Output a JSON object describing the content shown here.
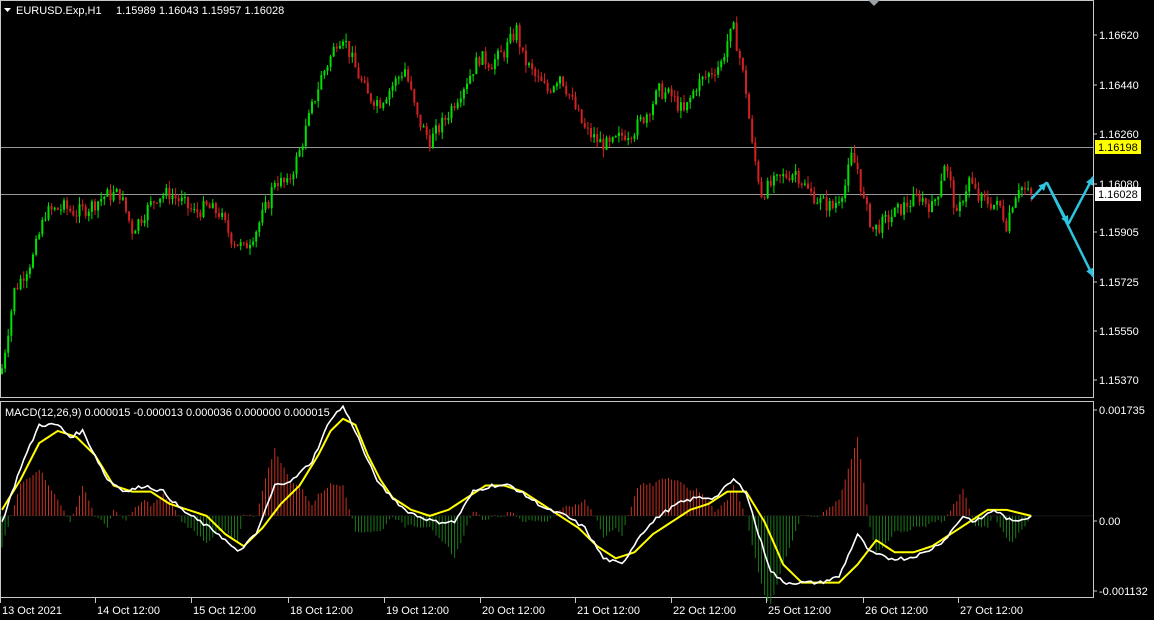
{
  "header": {
    "symbol": "EURUSD.Exp,H1",
    "ohlc": "1.15989 1.16043 1.15957 1.16028"
  },
  "macd_header": "MACD(12,26,9) 0.000015 -0.000013 0.000036 0.000000 0.000015",
  "colors": {
    "bull": "#00e000",
    "bear": "#d42020",
    "grid_line": "#c8c8c8",
    "price_tag_yellow": "#ffff00",
    "price_tag_white": "#ffffff",
    "arrow": "#2ec4de",
    "macd_line": "#ffffff",
    "signal_line": "#ffff00",
    "hist_pos": "#c83020",
    "hist_neg": "#1a7a1a"
  },
  "chart_data": [
    {
      "type": "candlestick",
      "timeframe": "H1",
      "ylim": [
        1.153,
        1.1672
      ],
      "y_ticks": [
        "1.16620",
        "1.16440",
        "1.16260",
        "1.16080",
        "1.15905",
        "1.15725",
        "1.15550",
        "1.15370"
      ],
      "x_ticks": [
        "13 Oct 2021",
        "14 Oct 12:00",
        "15 Oct 12:00",
        "18 Oct 12:00",
        "19 Oct 12:00",
        "20 Oct 12:00",
        "21 Oct 12:00",
        "22 Oct 12:00",
        "25 Oct 12:00",
        "26 Oct 12:00",
        "27 Oct 12:00"
      ],
      "horizontal_lines": [
        {
          "price": 1.16198,
          "label": "1.16198",
          "tag": "yellow"
        },
        {
          "price": 1.16028,
          "label": "1.16028",
          "tag": "white"
        }
      ],
      "close_path": [
        [
          0,
          1.154
        ],
        [
          4,
          1.1568
        ],
        [
          10,
          1.158
        ],
        [
          14,
          1.1596
        ],
        [
          20,
          1.1598
        ],
        [
          24,
          1.1596
        ],
        [
          28,
          1.1598
        ],
        [
          33,
          1.1602
        ],
        [
          38,
          1.1603
        ],
        [
          42,
          1.159
        ],
        [
          46,
          1.1596
        ],
        [
          50,
          1.1602
        ],
        [
          54,
          1.1603
        ],
        [
          58,
          1.16
        ],
        [
          62,
          1.1596
        ],
        [
          66,
          1.1598
        ],
        [
          70,
          1.1596
        ],
        [
          74,
          1.1587
        ],
        [
          78,
          1.1583
        ],
        [
          82,
          1.159
        ],
        [
          86,
          1.16
        ],
        [
          88,
          1.1608
        ],
        [
          92,
          1.1606
        ],
        [
          96,
          1.1618
        ],
        [
          100,
          1.1634
        ],
        [
          103,
          1.1645
        ],
        [
          106,
          1.1652
        ],
        [
          108,
          1.1658
        ],
        [
          110,
          1.166
        ],
        [
          114,
          1.1648
        ],
        [
          118,
          1.1638
        ],
        [
          122,
          1.1636
        ],
        [
          126,
          1.1642
        ],
        [
          130,
          1.1648
        ],
        [
          134,
          1.163
        ],
        [
          138,
          1.1622
        ],
        [
          142,
          1.1628
        ],
        [
          146,
          1.1636
        ],
        [
          150,
          1.1644
        ],
        [
          154,
          1.1652
        ],
        [
          158,
          1.165
        ],
        [
          162,
          1.1654
        ],
        [
          166,
          1.1662
        ],
        [
          168,
          1.1652
        ],
        [
          172,
          1.1645
        ],
        [
          176,
          1.164
        ],
        [
          180,
          1.1646
        ],
        [
          184,
          1.1636
        ],
        [
          188,
          1.1626
        ],
        [
          192,
          1.1622
        ],
        [
          196,
          1.162
        ],
        [
          200,
          1.1624
        ],
        [
          204,
          1.1626
        ],
        [
          208,
          1.1632
        ],
        [
          212,
          1.164
        ],
        [
          216,
          1.1638
        ],
        [
          220,
          1.1632
        ],
        [
          224,
          1.1642
        ],
        [
          228,
          1.1646
        ],
        [
          232,
          1.165
        ],
        [
          234,
          1.1658
        ],
        [
          236,
          1.1662
        ],
        [
          238,
          1.1652
        ],
        [
          240,
          1.164
        ],
        [
          242,
          1.162
        ],
        [
          245,
          1.1603
        ],
        [
          248,
          1.1606
        ],
        [
          252,
          1.1609
        ],
        [
          256,
          1.1611
        ],
        [
          260,
          1.1604
        ],
        [
          264,
          1.16
        ],
        [
          268,
          1.1598
        ],
        [
          272,
          1.1606
        ],
        [
          274,
          1.1616
        ],
        [
          276,
          1.1612
        ],
        [
          278,
          1.16
        ],
        [
          281,
          1.159
        ],
        [
          284,
          1.1592
        ],
        [
          288,
          1.1596
        ],
        [
          292,
          1.1599
        ],
        [
          296,
          1.1602
        ],
        [
          300,
          1.1598
        ],
        [
          302,
          1.1604
        ],
        [
          304,
          1.1614
        ],
        [
          306,
          1.1606
        ],
        [
          308,
          1.1594
        ],
        [
          310,
          1.1602
        ],
        [
          312,
          1.1608
        ],
        [
          315,
          1.1601
        ],
        [
          318,
          1.16
        ],
        [
          322,
          1.1598
        ],
        [
          324,
          1.1592
        ],
        [
          326,
          1.16
        ],
        [
          328,
          1.1606
        ],
        [
          330,
          1.1604
        ],
        [
          332,
          1.1602
        ]
      ],
      "annotation_arrows": [
        {
          "from": [
            332,
            1.1601
          ],
          "to": [
            337,
            1.1607
          ]
        },
        {
          "from": [
            337,
            1.1607
          ],
          "to": [
            344,
            1.1592
          ]
        },
        {
          "from": [
            344,
            1.1592
          ],
          "to": [
            352,
            1.1609
          ]
        },
        {
          "from": [
            337,
            1.1607
          ],
          "to": [
            352,
            1.1573
          ]
        }
      ]
    },
    {
      "type": "macd",
      "title": "MACD(12,26,9)",
      "ylim": [
        -0.00132,
        0.00186
      ],
      "y_ticks": [
        "0.001735",
        "0.00",
        "-0.001132"
      ],
      "macd_path": [
        [
          0,
          -0.0001
        ],
        [
          6,
          0.0008
        ],
        [
          12,
          0.0015
        ],
        [
          18,
          0.0015
        ],
        [
          22,
          0.0013
        ],
        [
          26,
          0.0014
        ],
        [
          30,
          0.001
        ],
        [
          34,
          0.0006
        ],
        [
          40,
          0.0004
        ],
        [
          46,
          0.0005
        ],
        [
          52,
          0.0004
        ],
        [
          58,
          0.0001
        ],
        [
          64,
          -0.0001
        ],
        [
          70,
          -0.0003
        ],
        [
          76,
          -0.0006
        ],
        [
          82,
          -0.0003
        ],
        [
          88,
          0.0005
        ],
        [
          94,
          0.0006
        ],
        [
          100,
          0.0009
        ],
        [
          106,
          0.0016
        ],
        [
          110,
          0.0018
        ],
        [
          114,
          0.0014
        ],
        [
          118,
          0.0009
        ],
        [
          122,
          0.0005
        ],
        [
          126,
          0.0003
        ],
        [
          130,
          0.0001
        ],
        [
          134,
          0.0
        ],
        [
          140,
          -0.0001
        ],
        [
          146,
          -0.0001
        ],
        [
          152,
          0.0004
        ],
        [
          158,
          0.0005
        ],
        [
          164,
          0.0005
        ],
        [
          170,
          0.0003
        ],
        [
          176,
          0.0001
        ],
        [
          182,
          0.0
        ],
        [
          188,
          -0.0002
        ],
        [
          194,
          -0.0007
        ],
        [
          200,
          -0.0008
        ],
        [
          206,
          -0.0003
        ],
        [
          212,
          0.0
        ],
        [
          218,
          0.0002
        ],
        [
          224,
          0.0003
        ],
        [
          230,
          0.0003
        ],
        [
          236,
          0.0006
        ],
        [
          240,
          0.0004
        ],
        [
          244,
          -0.0003
        ],
        [
          248,
          -0.0009
        ],
        [
          252,
          -0.0011
        ],
        [
          258,
          -0.0011
        ],
        [
          264,
          -0.0011
        ],
        [
          270,
          -0.001
        ],
        [
          276,
          -0.0003
        ],
        [
          280,
          -0.0006
        ],
        [
          286,
          -0.0007
        ],
        [
          292,
          -0.0007
        ],
        [
          298,
          -0.0006
        ],
        [
          304,
          -0.0004
        ],
        [
          310,
          0.0
        ],
        [
          314,
          -0.0001
        ],
        [
          320,
          0.0001
        ],
        [
          326,
          -0.0001
        ],
        [
          332,
          0.0
        ]
      ],
      "signal_path": [
        [
          0,
          0.0001
        ],
        [
          6,
          0.0006
        ],
        [
          12,
          0.0012
        ],
        [
          18,
          0.0014
        ],
        [
          24,
          0.0013
        ],
        [
          30,
          0.001
        ],
        [
          36,
          0.0005
        ],
        [
          42,
          0.0004
        ],
        [
          48,
          0.0004
        ],
        [
          54,
          0.0002
        ],
        [
          60,
          0.0001
        ],
        [
          66,
          0.0
        ],
        [
          72,
          -0.0003
        ],
        [
          78,
          -0.0005
        ],
        [
          84,
          -0.0002
        ],
        [
          90,
          0.0002
        ],
        [
          96,
          0.0005
        ],
        [
          102,
          0.001
        ],
        [
          106,
          0.0014
        ],
        [
          110,
          0.0016
        ],
        [
          114,
          0.0015
        ],
        [
          118,
          0.001
        ],
        [
          122,
          0.0006
        ],
        [
          126,
          0.0003
        ],
        [
          132,
          0.0001
        ],
        [
          138,
          0.0
        ],
        [
          144,
          0.0001
        ],
        [
          150,
          0.0003
        ],
        [
          156,
          0.0005
        ],
        [
          162,
          0.0005
        ],
        [
          168,
          0.0004
        ],
        [
          174,
          0.0002
        ],
        [
          180,
          0.0
        ],
        [
          186,
          -0.0002
        ],
        [
          192,
          -0.0005
        ],
        [
          198,
          -0.0007
        ],
        [
          204,
          -0.0006
        ],
        [
          210,
          -0.0003
        ],
        [
          216,
          -0.0001
        ],
        [
          222,
          0.0001
        ],
        [
          228,
          0.0002
        ],
        [
          234,
          0.0004
        ],
        [
          240,
          0.0004
        ],
        [
          246,
          -0.0001
        ],
        [
          252,
          -0.0008
        ],
        [
          258,
          -0.0011
        ],
        [
          264,
          -0.0011
        ],
        [
          270,
          -0.0011
        ],
        [
          276,
          -0.0008
        ],
        [
          282,
          -0.0004
        ],
        [
          288,
          -0.0006
        ],
        [
          294,
          -0.0006
        ],
        [
          300,
          -0.0005
        ],
        [
          306,
          -0.0003
        ],
        [
          312,
          -0.0001
        ],
        [
          318,
          0.0001
        ],
        [
          324,
          0.0001
        ],
        [
          332,
          0.0
        ]
      ]
    }
  ]
}
